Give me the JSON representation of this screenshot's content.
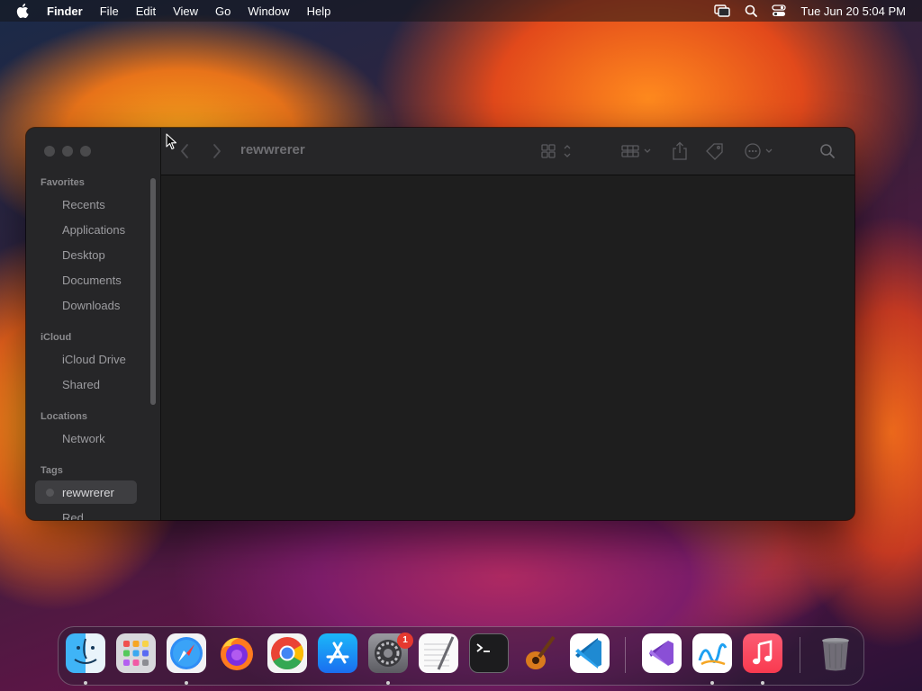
{
  "menubar": {
    "app_name": "Finder",
    "menus": [
      "File",
      "Edit",
      "View",
      "Go",
      "Window",
      "Help"
    ],
    "clock": "Tue Jun 20  5:04 PM",
    "status_icons": [
      "screen-mirroring-icon",
      "spotlight-search-icon",
      "control-center-icon"
    ]
  },
  "window": {
    "title": "rewwrerer",
    "sidebar": {
      "favorites_label": "Favorites",
      "favorites": [
        "Recents",
        "Applications",
        "Desktop",
        "Documents",
        "Downloads"
      ],
      "icloud_label": "iCloud",
      "icloud": [
        "iCloud Drive",
        "Shared"
      ],
      "locations_label": "Locations",
      "locations": [
        "Network"
      ],
      "tags_label": "Tags",
      "tags": [
        "rewwrerer",
        "Red"
      ],
      "selected": "rewwrerer"
    },
    "toolbar_icons": [
      "back-icon",
      "forward-icon",
      "view-mode-icon",
      "group-icon",
      "share-icon",
      "tag-icon",
      "more-actions-icon",
      "search-icon"
    ]
  },
  "dock": {
    "apps": [
      {
        "name": "Finder",
        "running": true
      },
      {
        "name": "Launchpad",
        "running": false
      },
      {
        "name": "Safari",
        "running": true
      },
      {
        "name": "Firefox",
        "running": false
      },
      {
        "name": "Google Chrome",
        "running": false
      },
      {
        "name": "App Store",
        "running": false
      },
      {
        "name": "System Settings",
        "running": true,
        "badge": "1"
      },
      {
        "name": "TextEdit",
        "running": false
      },
      {
        "name": "Terminal",
        "running": false
      },
      {
        "name": "GarageBand",
        "running": false
      },
      {
        "name": "Visual Studio Code",
        "running": false
      },
      {
        "name": "Visual Studio",
        "running": false
      },
      {
        "name": "Freeform",
        "running": true
      },
      {
        "name": "Music",
        "running": true
      },
      {
        "name": "Trash",
        "running": false
      }
    ]
  }
}
